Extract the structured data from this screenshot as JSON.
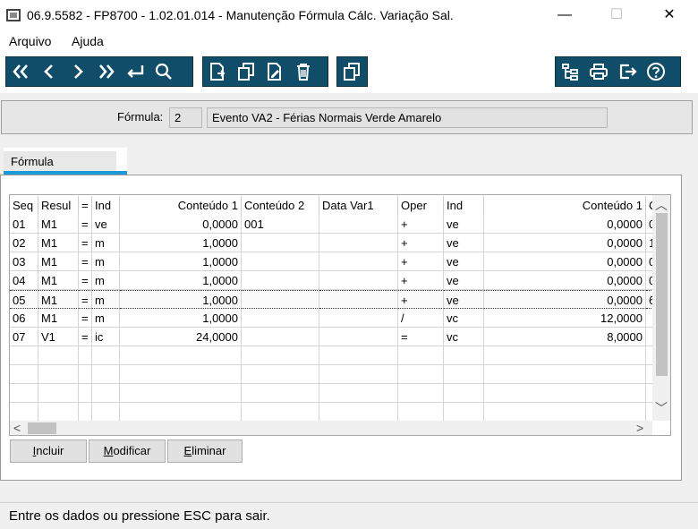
{
  "window": {
    "title": "06.9.5582 - FP8700 - 1.02.01.014 - Manutenção Fórmula Cálc. Variação Sal.",
    "minimize": "—",
    "maximize": "☐",
    "close": "✕"
  },
  "menu": {
    "items": [
      "Arquivo",
      "Ajuda"
    ]
  },
  "toolbar": {
    "nav_icons": [
      "first-icon",
      "previous-icon",
      "next-icon",
      "last-icon",
      "enter-icon",
      "search-icon"
    ],
    "edit_icons": [
      "new-icon",
      "copy-icon",
      "edit-icon",
      "delete-icon"
    ],
    "extra_icons": [
      "duplicate-icon"
    ],
    "right_icons": [
      "tree-icon",
      "print-icon",
      "exit-icon",
      "help-icon"
    ],
    "accent_color": "#0f4d68"
  },
  "header": {
    "formula_label": "Fórmula:",
    "formula_code": "2",
    "formula_desc": "Evento VA2 - Férias Normais Verde Amarelo"
  },
  "tabs": [
    {
      "label": "Fórmula",
      "active": true
    }
  ],
  "grid": {
    "columns": [
      "Seq",
      "Resul",
      "=",
      "Ind",
      "Conteúdo 1",
      "Conteúdo 2",
      "Data Var1",
      "Oper",
      "Ind",
      "Conteúdo 1",
      "C"
    ],
    "rows": [
      [
        "01",
        "M1",
        "=",
        "ve",
        "0,0000",
        "001",
        "",
        "+",
        "ve",
        "0,0000",
        "0"
      ],
      [
        "02",
        "M1",
        "=",
        "m",
        "1,0000",
        "",
        "",
        "+",
        "ve",
        "0,0000",
        "1"
      ],
      [
        "03",
        "M1",
        "=",
        "m",
        "1,0000",
        "",
        "",
        "+",
        "ve",
        "0,0000",
        "0"
      ],
      [
        "04",
        "M1",
        "=",
        "m",
        "1,0000",
        "",
        "",
        "+",
        "ve",
        "0,0000",
        "0"
      ],
      [
        "05",
        "M1",
        "=",
        "m",
        "1,0000",
        "",
        "",
        "+",
        "ve",
        "0,0000",
        "6"
      ],
      [
        "06",
        "M1",
        "=",
        "m",
        "1,0000",
        "",
        "",
        "/",
        "vc",
        "12,0000",
        ""
      ],
      [
        "07",
        "V1",
        "=",
        "ic",
        "24,0000",
        "",
        "",
        "=",
        "vc",
        "8,0000",
        ""
      ]
    ],
    "selected_row": 4,
    "scroll_up": "︿",
    "scroll_down": "﹀",
    "scroll_left": "<",
    "scroll_right": ">"
  },
  "buttons": {
    "incluir": "Incluir",
    "modificar": "Modificar",
    "eliminar": "Eliminar"
  },
  "status": {
    "text": "Entre os dados ou pressione ESC para sair."
  }
}
